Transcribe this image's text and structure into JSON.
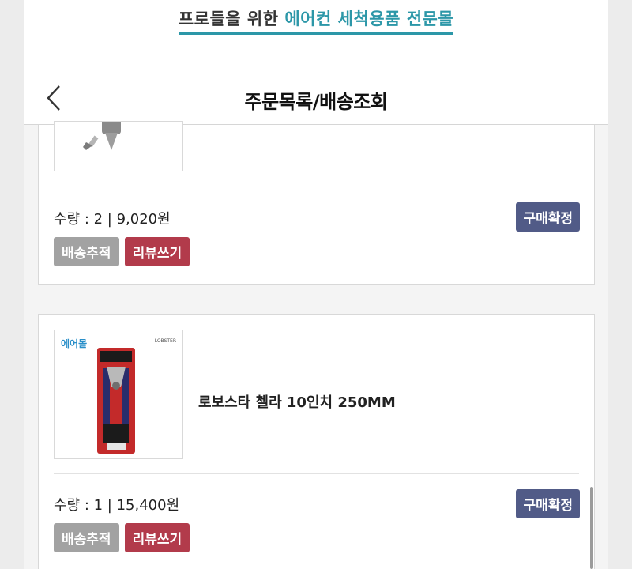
{
  "banner": {
    "text_plain": "프로들을 위한",
    "text_accent": "에어컨 세척용품 전문몰",
    "colors": {
      "accent": "#2c97a8"
    }
  },
  "header": {
    "title": "주문목록/배송조회",
    "back_icon": "chevron-left-icon"
  },
  "orders": [
    {
      "product_name": "",
      "quantity_price": "수량 : 2 | 9,020원",
      "confirm_label": "구매확정",
      "track_label": "배송추적",
      "review_label": "리뷰쓰기"
    },
    {
      "thumb_logo": "에어몰",
      "thumb_brand": "LOBSTER",
      "product_name": "로보스타 첼라 10인치 250MM",
      "quantity_price": "수량 : 1 | 15,400원",
      "confirm_label": "구매확정",
      "track_label": "배송추적",
      "review_label": "리뷰쓰기"
    }
  ],
  "colors": {
    "confirm": "#515b87",
    "track": "#a2a2a2",
    "review": "#b23b4b"
  }
}
